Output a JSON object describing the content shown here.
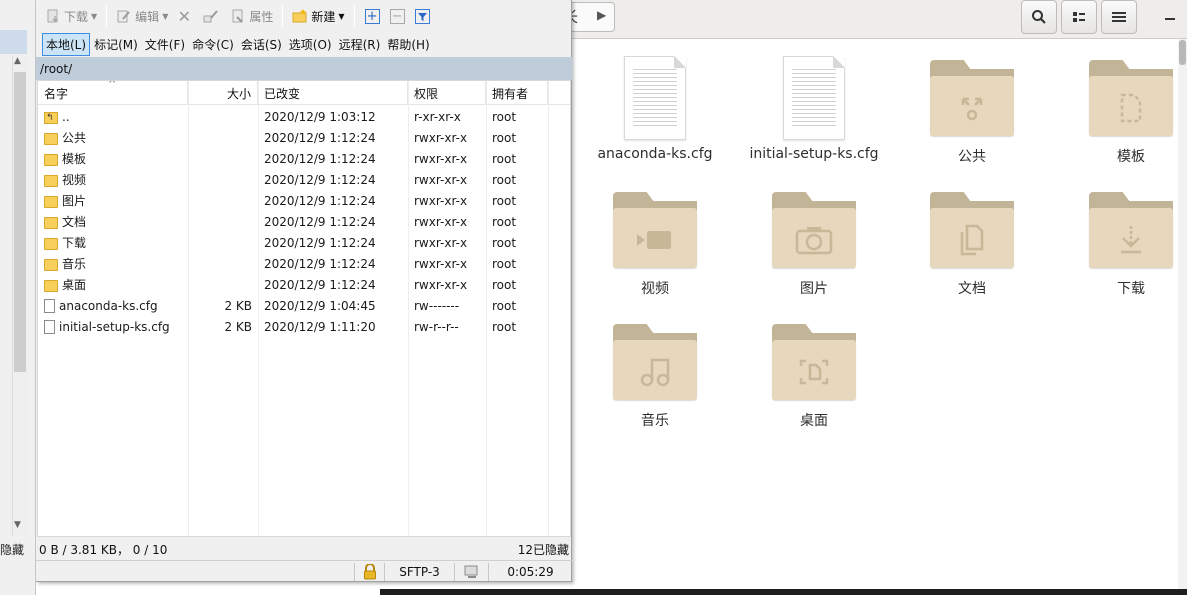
{
  "background_file_manager": {
    "path_partial": "长",
    "items": [
      {
        "label": "anaconda-ks.cfg",
        "kind": "document"
      },
      {
        "label": "initial-setup-ks.cfg",
        "kind": "document"
      },
      {
        "label": "公共",
        "kind": "folder",
        "glyph": "share-icon"
      },
      {
        "label": "模板",
        "kind": "folder",
        "glyph": "template-icon"
      },
      {
        "label": "视频",
        "kind": "folder",
        "glyph": "video-camera-icon"
      },
      {
        "label": "图片",
        "kind": "folder",
        "glyph": "camera-icon"
      },
      {
        "label": "文档",
        "kind": "folder",
        "glyph": "documents-icon"
      },
      {
        "label": "下载",
        "kind": "folder",
        "glyph": "download-icon"
      },
      {
        "label": "音乐",
        "kind": "folder",
        "glyph": "music-note-icon"
      },
      {
        "label": "桌面",
        "kind": "folder",
        "glyph": "desktop-icon"
      }
    ]
  },
  "left_panel": {
    "status_partial": "已隐藏"
  },
  "toolbar": {
    "download_label": "下载",
    "edit_label": "编辑",
    "properties_label": "属性",
    "new_label": "新建"
  },
  "menu": {
    "items": [
      "本地(L)",
      "标记(M)",
      "文件(F)",
      "命令(C)",
      "会话(S)",
      "选项(O)",
      "远程(R)",
      "帮助(H)"
    ]
  },
  "path": "/root/",
  "columns": {
    "name": "名字",
    "size": "大小",
    "changed": "已改变",
    "rights": "权限",
    "owner": "拥有者"
  },
  "files": [
    {
      "name": "..",
      "size": "",
      "changed": "2020/12/9 1:03:12",
      "rights": "r-xr-xr-x",
      "owner": "root",
      "type": "parent"
    },
    {
      "name": "公共",
      "size": "",
      "changed": "2020/12/9 1:12:24",
      "rights": "rwxr-xr-x",
      "owner": "root",
      "type": "folder"
    },
    {
      "name": "模板",
      "size": "",
      "changed": "2020/12/9 1:12:24",
      "rights": "rwxr-xr-x",
      "owner": "root",
      "type": "folder"
    },
    {
      "name": "视频",
      "size": "",
      "changed": "2020/12/9 1:12:24",
      "rights": "rwxr-xr-x",
      "owner": "root",
      "type": "folder"
    },
    {
      "name": "图片",
      "size": "",
      "changed": "2020/12/9 1:12:24",
      "rights": "rwxr-xr-x",
      "owner": "root",
      "type": "folder"
    },
    {
      "name": "文档",
      "size": "",
      "changed": "2020/12/9 1:12:24",
      "rights": "rwxr-xr-x",
      "owner": "root",
      "type": "folder"
    },
    {
      "name": "下载",
      "size": "",
      "changed": "2020/12/9 1:12:24",
      "rights": "rwxr-xr-x",
      "owner": "root",
      "type": "folder"
    },
    {
      "name": "音乐",
      "size": "",
      "changed": "2020/12/9 1:12:24",
      "rights": "rwxr-xr-x",
      "owner": "root",
      "type": "folder"
    },
    {
      "name": "桌面",
      "size": "",
      "changed": "2020/12/9 1:12:24",
      "rights": "rwxr-xr-x",
      "owner": "root",
      "type": "folder"
    },
    {
      "name": "anaconda-ks.cfg",
      "size": "2 KB",
      "changed": "2020/12/9 1:04:45",
      "rights": "rw-------",
      "owner": "root",
      "type": "file"
    },
    {
      "name": "initial-setup-ks.cfg",
      "size": "2 KB",
      "changed": "2020/12/9 1:11:20",
      "rights": "rw-r--r--",
      "owner": "root",
      "type": "file"
    }
  ],
  "status": {
    "selection": "0 B / 3.81 KB， 0 / 10",
    "hidden": "12已隐藏"
  },
  "connection": {
    "protocol": "SFTP-3",
    "elapsed": "0:05:29"
  },
  "colors": {
    "folder_tab": "#c2b497",
    "folder_body": "#e6d7bd",
    "path_bar": "#bfcddb",
    "selected_menu": "#cce4f7"
  }
}
